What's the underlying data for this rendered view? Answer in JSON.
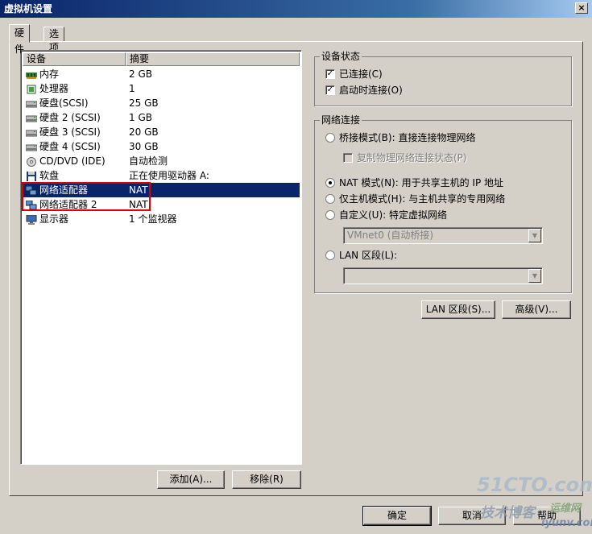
{
  "window": {
    "title": "虚拟机设置",
    "close_glyph": "×"
  },
  "tabs": [
    {
      "label": "硬件",
      "active": true
    },
    {
      "label": "选项",
      "active": false
    }
  ],
  "device_list": {
    "columns": [
      "设备",
      "摘要"
    ],
    "rows": [
      {
        "name": "内存",
        "summary": "2 GB",
        "icon": "memory-icon"
      },
      {
        "name": "处理器",
        "summary": "1",
        "icon": "cpu-icon"
      },
      {
        "name": "硬盘(SCSI)",
        "summary": "25 GB",
        "icon": "hard-disk-icon"
      },
      {
        "name": "硬盘 2 (SCSI)",
        "summary": "1 GB",
        "icon": "hard-disk-icon"
      },
      {
        "name": "硬盘 3 (SCSI)",
        "summary": "20 GB",
        "icon": "hard-disk-icon"
      },
      {
        "name": "硬盘 4 (SCSI)",
        "summary": "30 GB",
        "icon": "hard-disk-icon"
      },
      {
        "name": "CD/DVD (IDE)",
        "summary": "自动检测",
        "icon": "cd-dvd-icon"
      },
      {
        "name": "软盘",
        "summary": "正在使用驱动器 A:",
        "icon": "floppy-icon"
      },
      {
        "name": "网络适配器",
        "summary": "NAT",
        "icon": "network-adapter-icon",
        "selected": true
      },
      {
        "name": "网络适配器 2",
        "summary": "NAT",
        "icon": "network-adapter-icon"
      },
      {
        "name": "显示器",
        "summary": "1 个监视器",
        "icon": "monitor-icon"
      }
    ]
  },
  "list_buttons": {
    "add": "添加(A)...",
    "remove": "移除(R)"
  },
  "device_status": {
    "title": "设备状态",
    "connected": {
      "label": "已连接(C)",
      "checked": true
    },
    "connect_at_power_on": {
      "label": "启动时连接(O)",
      "checked": true
    }
  },
  "network_connection": {
    "title": "网络连接",
    "bridged": {
      "label": "桥接模式(B): 直接连接物理网络",
      "selected": false
    },
    "replicate": {
      "label": "复制物理网络连接状态(P)",
      "checked": false
    },
    "nat": {
      "label": "NAT 模式(N): 用于共享主机的 IP 地址",
      "selected": true
    },
    "host_only": {
      "label": "仅主机模式(H): 与主机共享的专用网络",
      "selected": false
    },
    "custom": {
      "label": "自定义(U): 特定虚拟网络",
      "selected": false
    },
    "custom_value": "VMnet0 (自动桥接)",
    "lan_segment": {
      "label": "LAN 区段(L):",
      "selected": false
    },
    "lan_segment_value": ""
  },
  "side_buttons": {
    "lan_segments": "LAN 区段(S)...",
    "advanced": "高级(V)..."
  },
  "dialog_buttons": {
    "ok": "确定",
    "cancel": "取消",
    "help": "帮助"
  },
  "watermarks": {
    "site": "51CTO.com",
    "blog": "技术博客",
    "brand": "运维网",
    "url": "iyunv.com"
  }
}
